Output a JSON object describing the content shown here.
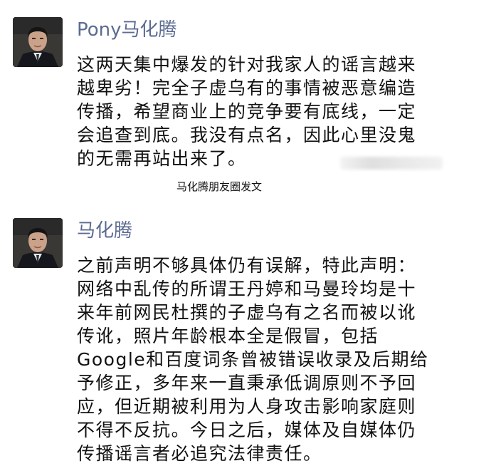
{
  "posts": [
    {
      "author": "Pony马化腾",
      "lines": [
        "这两天集中爆发的针对我家人的谣言越来",
        "越卑劣！完全子虚乌有的事情被恶意编造",
        "传播，希望商业上的竞争要有底线，一定",
        "会追查到底。我没有点名，因此心里没鬼",
        "的无需再站出来了。"
      ]
    },
    {
      "author": "马化腾",
      "lines": [
        "之前声明不够具体仍有误解，特此声明：",
        "网络中乱传的所谓王丹婷和马曼玲均是十",
        "来年前网民杜撰的子虚乌有之名而被以讹",
        "传讹，照片年龄根本全是假冒，包括",
        "Google和百度词条曾被错误收录及后期给",
        "予修正，多年来一直秉承低调原则不予回",
        "应，但近期被利用为人身攻击影响家庭则",
        "不得不反抗。今日之后，媒体及自媒体仍",
        "传播谣言者必追究法律责任。"
      ]
    }
  ],
  "caption": "马化腾朋友圈发文"
}
